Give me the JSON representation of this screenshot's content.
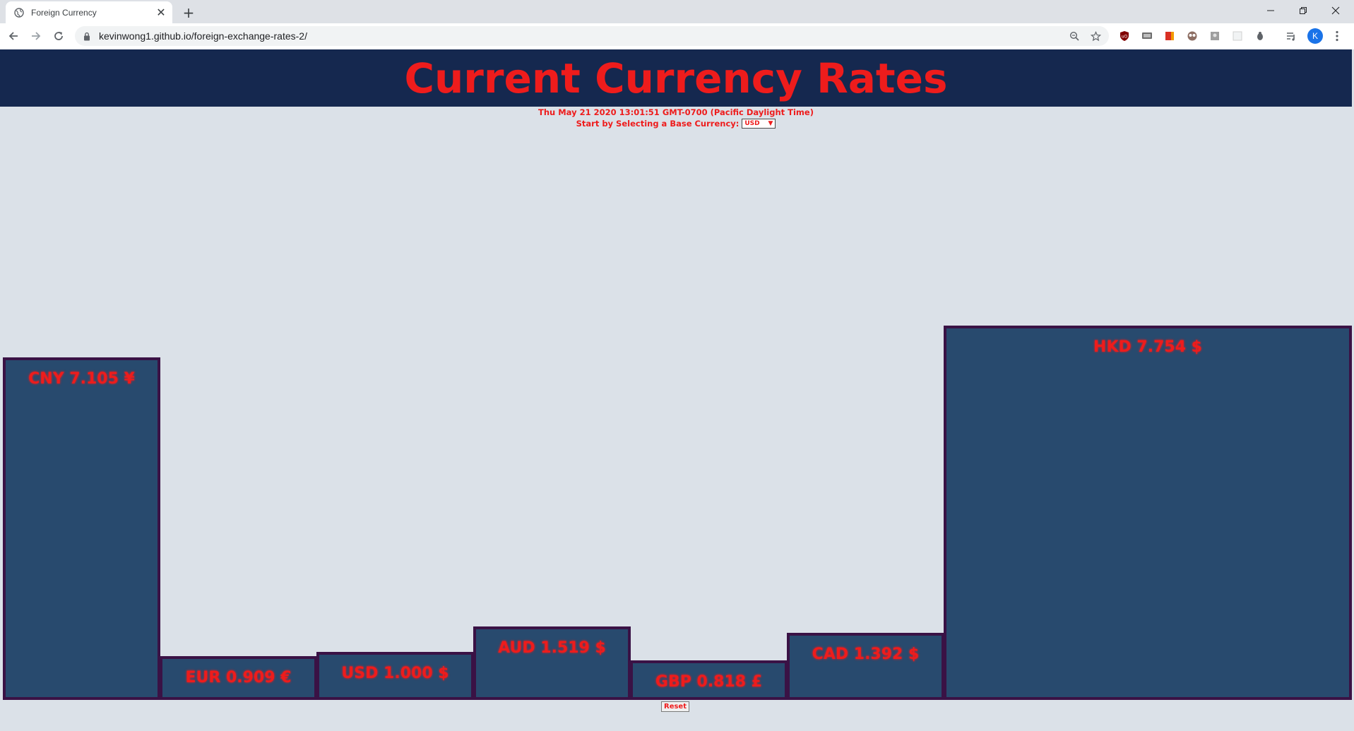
{
  "browser": {
    "tab_title": "Foreign Currency",
    "new_tab_label": "+",
    "url": "kevinwong1.github.io/foreign-exchange-rates-2/",
    "avatar_letter": "K"
  },
  "page": {
    "title": "Current Currency Rates",
    "datetime": "Thu May 21 2020 13:01:51 GMT-0700 (Pacific Daylight Time)",
    "selector_label": "Start by Selecting a Base Currency:",
    "selected_currency": "USD",
    "reset_label": "Reset"
  },
  "colors": {
    "header_bg": "#15284f",
    "title_red": "#ee1c1c",
    "bar_fill": "#284a6e",
    "bar_border": "#3a1245",
    "page_bg": "#dbe1e8"
  },
  "chart_data": {
    "type": "bar",
    "categories": [
      "CNY",
      "EUR",
      "USD",
      "AUD",
      "GBP",
      "CAD",
      "HKD"
    ],
    "values": [
      7.105,
      0.909,
      1.0,
      1.519,
      0.818,
      1.392,
      7.754
    ],
    "symbols": [
      "¥",
      "€",
      "$",
      "$",
      "£",
      "$",
      "$"
    ],
    "labels": [
      "CNY 7.105 ¥",
      "EUR 0.909 €",
      "USD 1.000 $",
      "AUD 1.519 $",
      "GBP 0.818 £",
      "CAD 1.392 $",
      "HKD 7.754 $"
    ],
    "title": "",
    "xlabel": "",
    "ylabel": "",
    "grid": false
  }
}
